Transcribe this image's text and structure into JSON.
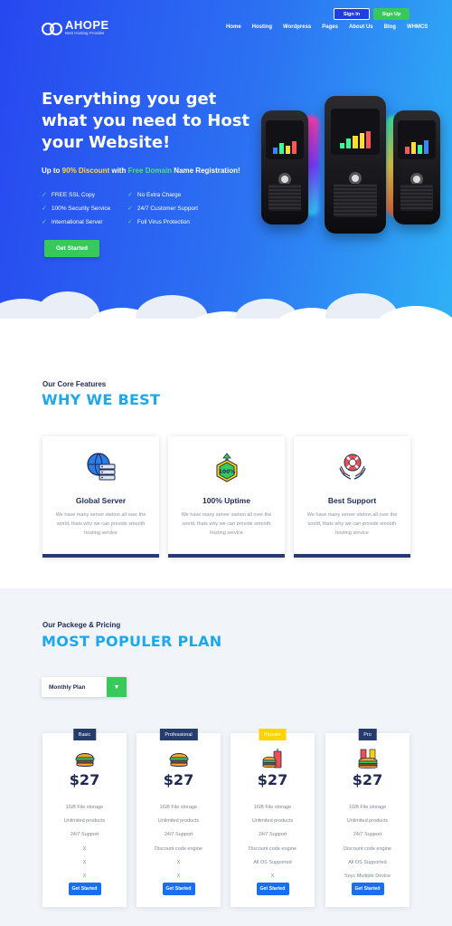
{
  "header": {
    "brand": "AHOPE",
    "tagline": "Best Hosting Provider",
    "signin_label": "Sign In",
    "signup_label": "Sign Up",
    "nav": [
      "Home",
      "Hosting",
      "Wordpress",
      "Pages",
      "About Us",
      "Blog",
      "WHMCS"
    ]
  },
  "hero": {
    "title": "Everything you get what you need to Host your Website!",
    "subline_prefix": "Up to ",
    "subline_highlight1": "90% Discount",
    "subline_mid": " with ",
    "subline_highlight2": "Free Domain",
    "subline_suffix": " Name Registration!",
    "features": [
      "FREE SSL Copy",
      "No Extra Charge",
      "100% Security Service",
      "24/7 Customer Support",
      "International Server",
      "Full Virus Protection"
    ],
    "cta_label": "Get Started"
  },
  "features_section": {
    "subtitle": "Our Core Features",
    "title": "WHY WE BEST",
    "cards": [
      {
        "title": "Global Server",
        "text": "We have many server stetion all over the world, thats why we can provide smooth hosting service",
        "icon": "global-server-icon"
      },
      {
        "title": "100% Uptime",
        "text": "We have many server stetion all over the world, thats why we can provide smooth hosting service",
        "icon": "uptime-badge-icon"
      },
      {
        "title": "Best Support",
        "text": "We have many server stetion all over the world, thats why we can provide smooth hosting service",
        "icon": "support-lifebuoy-icon"
      }
    ]
  },
  "pricing_section": {
    "subtitle": "Our Packege & Pricing",
    "title": "MOST POPULER PLAN",
    "select_value": "Monthly Plan",
    "plans": [
      {
        "tag": "Basic",
        "price": "$27",
        "icon": "burger-icon",
        "items": [
          "1GB File storage",
          "Unlimited products",
          "24/7 Support",
          "X",
          "X",
          "X"
        ],
        "button": "Get Started"
      },
      {
        "tag": "Professional",
        "price": "$27",
        "icon": "burger-icon",
        "items": [
          "1GB File storage",
          "Unlimited products",
          "24/7 Support",
          "Discount code engine",
          "X",
          "X"
        ],
        "button": "Get Started"
      },
      {
        "tag": "Populer",
        "price": "$27",
        "icon": "burger-drink-icon",
        "items": [
          "1GB File storage",
          "Unlimited products",
          "24/7 Support",
          "Discount code engine",
          "All OS Supported",
          "X"
        ],
        "button": "Get Started"
      },
      {
        "tag": "Pro",
        "price": "$27",
        "icon": "burger-combo-icon",
        "items": [
          "1GB File storage",
          "Unlimited products",
          "24/7 Support",
          "Discount code engine",
          "All OS Supported",
          "Snyc Multiple Device"
        ],
        "button": "Get Started"
      }
    ]
  },
  "colors": {
    "hero_start": "#2747f0",
    "hero_end": "#2fb2f6",
    "accent_green": "#38c95c",
    "title_blue": "#1aa9ef",
    "navy": "#263b6e",
    "popular_yellow": "#ffd200"
  }
}
